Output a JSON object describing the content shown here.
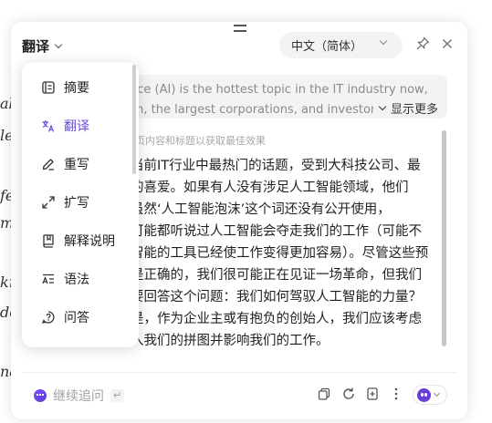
{
  "background_page": {
    "fragments": [
      "al",
      "le",
      "fe",
      "m",
      "kn",
      "de",
      "na"
    ]
  },
  "header": {
    "title": "翻译",
    "language_select": "中文（简体）"
  },
  "menu": {
    "items": [
      {
        "label": "摘要",
        "icon": "summary-icon"
      },
      {
        "label": "翻译",
        "icon": "translate-icon",
        "active": true
      },
      {
        "label": "重写",
        "icon": "rewrite-pen-icon"
      },
      {
        "label": "扩写",
        "icon": "expand-arrows-icon"
      },
      {
        "label": "解释说明",
        "icon": "book-icon"
      },
      {
        "label": "语法",
        "icon": "grammar-icon"
      },
      {
        "label": "问答",
        "icon": "question-icon"
      }
    ]
  },
  "source": {
    "line1": "nce (AI) is the hottest topic in the IT industry now,",
    "line2": "ch, the largest corporations, and investors",
    "show_more": "显示更多"
  },
  "hint": "页内容和标题以获取最佳效果",
  "result": {
    "lines": [
      "当前IT行业中最热门的话题，受到大科技公司、最",
      "的喜爱。如果有人没有涉足人工智能领域，他们",
      "虽然‘人工智能泡沫’这个词还没有公开使用，",
      "可能都听说过人工智能会夺走我们的工作（可能不",
      "智能的工具已经使工作变得更加容易）。尽管这些预",
      "是正确的，我们很可能正在见证一场革命，但我们",
      "要回答这个问题：我们如何驾驭人工智能的力量？",
      "是，作为企业主或有抱负的创始人，我们应该考虑",
      "入我们的拼图并影响我们的工作。"
    ]
  },
  "footer": {
    "followup_placeholder": "继续追问",
    "enter_key": "↵"
  },
  "colors": {
    "accent": "#6b48e0",
    "panel_bg": "#ffffff",
    "source_bg": "#f2f3f5"
  }
}
